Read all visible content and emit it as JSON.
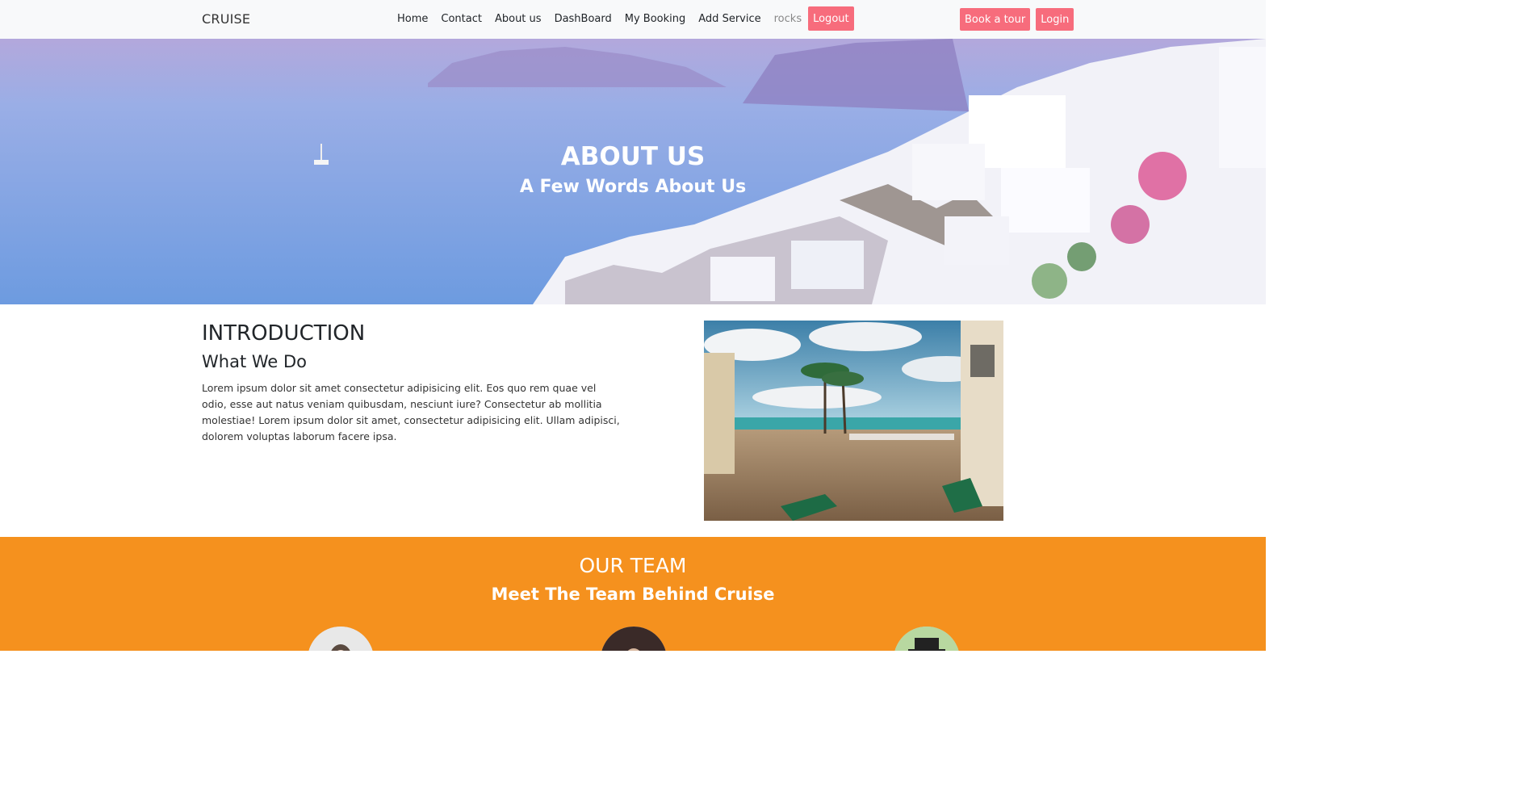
{
  "navbar": {
    "brand": "CRUISE",
    "links": [
      "Home",
      "Contact",
      "About us",
      "DashBoard",
      "My Booking",
      "Add Service"
    ],
    "username": "rocks",
    "logout": "Logout",
    "book_tour": "Book a tour",
    "login": "Login"
  },
  "hero": {
    "title": "ABOUT US",
    "subtitle": "A Few Words About Us"
  },
  "intro": {
    "title": "INTRODUCTION",
    "subtitle": "What We Do",
    "text": "Lorem ipsum dolor sit amet consectetur adipisicing elit. Eos quo rem quae vel odio, esse aut natus veniam quibusdam, nesciunt iure? Consectetur ab mollitia molestiae! Lorem ipsum dolor sit amet, consectetur adipisicing elit. Ullam adipisci, dolorem voluptas laborum facere ipsa."
  },
  "team": {
    "title": "OUR TEAM",
    "subtitle": "Meet The Team Behind Cruise"
  },
  "colors": {
    "accent": "#f76c7c",
    "team_bg": "#f5911e",
    "navbar_bg": "#f8f9fa"
  }
}
